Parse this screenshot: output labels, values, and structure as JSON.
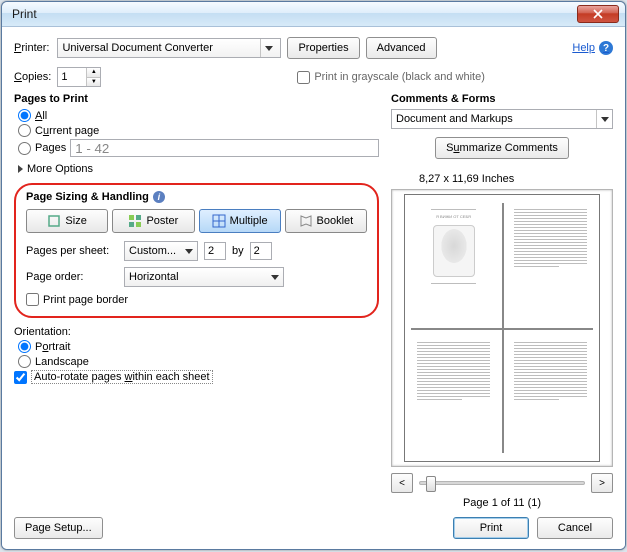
{
  "window_title": "Print",
  "help_label": "Help",
  "labels": {
    "printer": "Printer:",
    "properties": "Properties",
    "advanced": "Advanced",
    "copies": "Copies:",
    "grayscale": "Print in grayscale (black and white)",
    "pages_to_print": "Pages to Print",
    "all": "All",
    "current_page": "Current page",
    "pages": "Pages",
    "more_options": "More Options",
    "sizing_handling": "Page Sizing & Handling",
    "size": "Size",
    "poster": "Poster",
    "multiple": "Multiple",
    "booklet": "Booklet",
    "pages_per_sheet": "Pages per sheet:",
    "by": "by",
    "page_order": "Page order:",
    "print_page_border": "Print page border",
    "orientation": "Orientation:",
    "portrait": "Portrait",
    "landscape": "Landscape",
    "auto_rotate": "Auto-rotate pages within each sheet",
    "comments_forms": "Comments & Forms",
    "summarize": "Summarize Comments",
    "preview_dims": "8,27 x 11,69 Inches",
    "page_counter": "Page 1 of 11 (1)",
    "page_setup": "Page Setup...",
    "print": "Print",
    "cancel": "Cancel",
    "prev": "<",
    "next": ">"
  },
  "values": {
    "printer": "Universal Document Converter",
    "copies": "1",
    "pages_range": "1 - 42",
    "pages_per_sheet_mode": "Custom...",
    "pps_x": "2",
    "pps_y": "2",
    "page_order": "Horizontal",
    "comments_mode": "Document and Markups"
  },
  "state": {
    "pages_radio": "all",
    "mode_active": "multiple",
    "orientation": "portrait",
    "auto_rotate_checked": true,
    "print_border_checked": false,
    "grayscale_checked": false
  }
}
